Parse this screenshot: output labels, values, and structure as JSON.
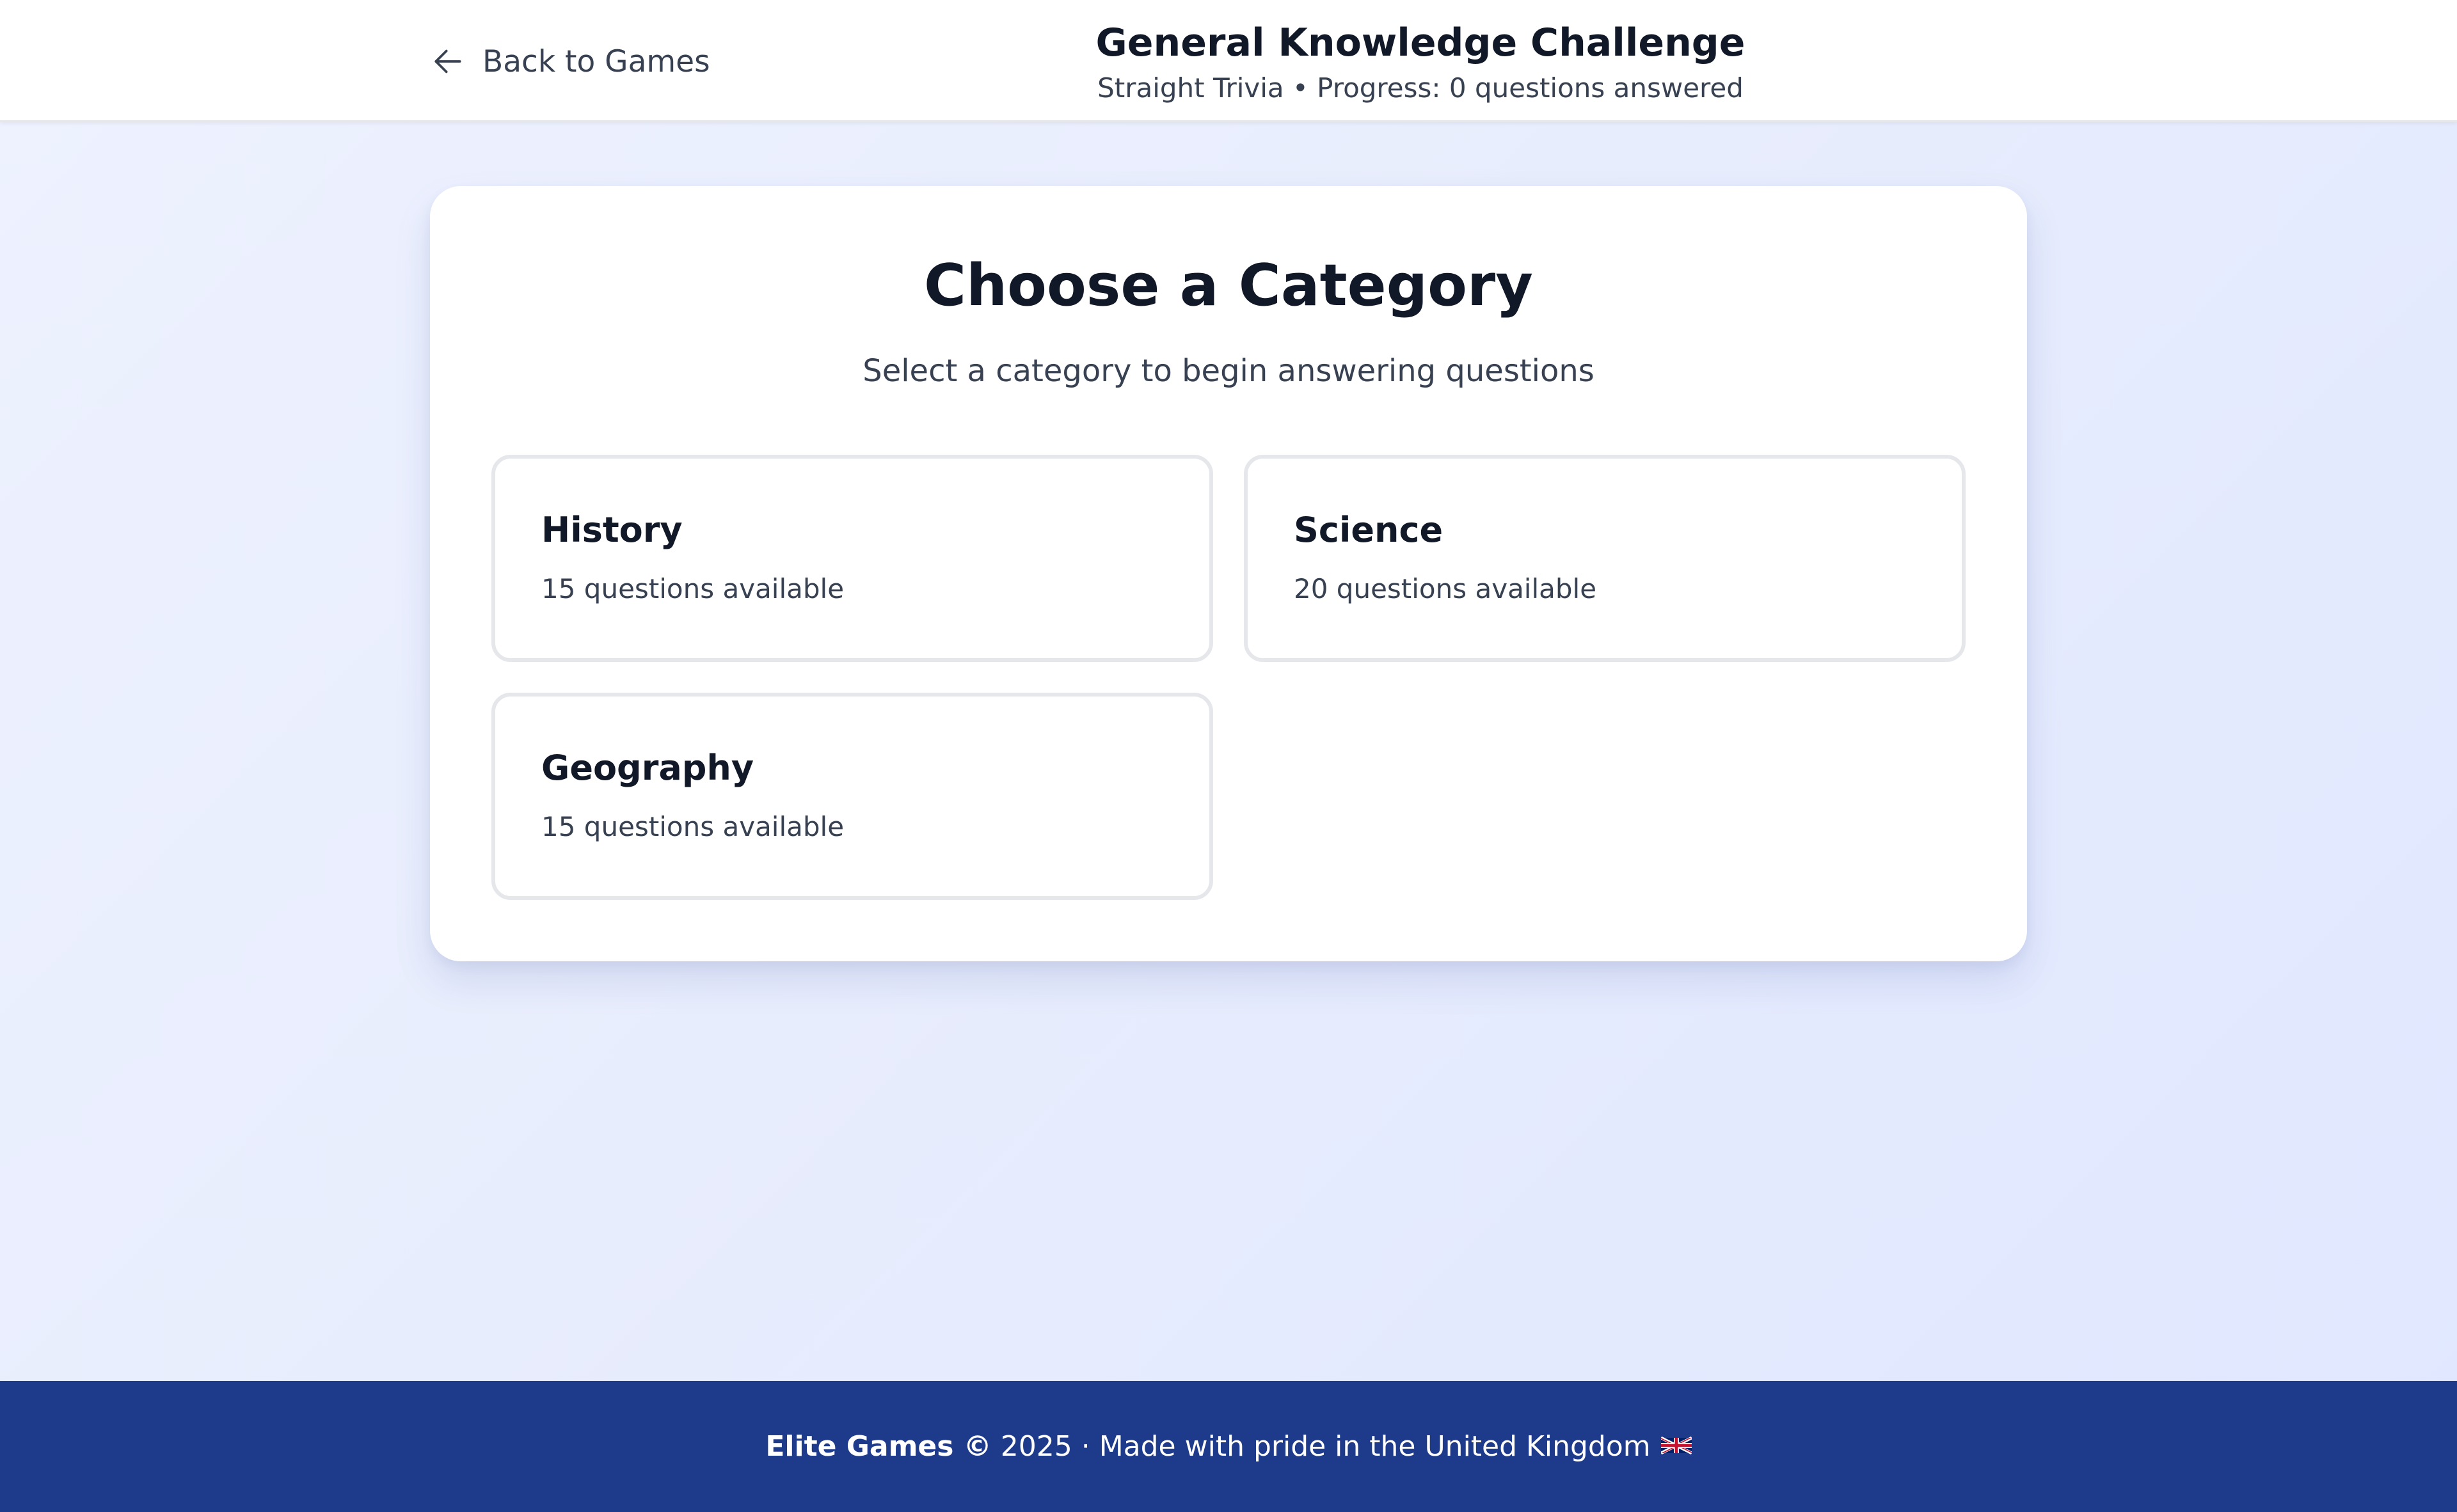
{
  "header": {
    "back_label": "Back to Games",
    "back_icon": "arrow-left-icon",
    "title": "General Knowledge Challenge",
    "subtitle": "Straight Trivia • Progress: 0 questions answered"
  },
  "main": {
    "title": "Choose a Category",
    "subtitle": "Select a category to begin answering questions",
    "categories": [
      {
        "name": "History",
        "count_label": "15 questions available"
      },
      {
        "name": "Science",
        "count_label": "20 questions available"
      },
      {
        "name": "Geography",
        "count_label": "15 questions available"
      }
    ]
  },
  "footer": {
    "brand": "Elite Games ©",
    "text": "2025 · Made with pride in the United Kingdom",
    "flag_icon": "uk-flag-icon"
  },
  "colors": {
    "footer_bg": "#1e3a8a",
    "text_dark": "#111827",
    "text_muted": "#374151",
    "card_border": "#e5e7eb",
    "page_bg": "#e8edfd"
  }
}
